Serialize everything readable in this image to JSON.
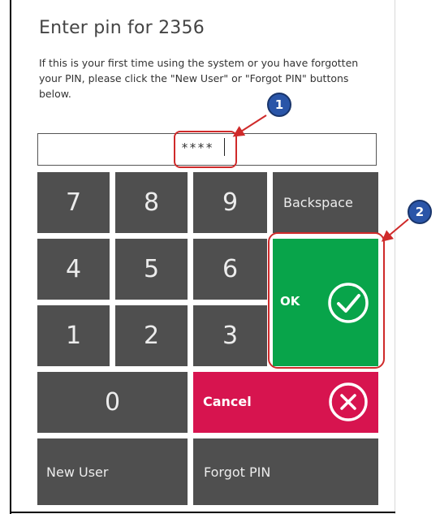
{
  "dialog": {
    "title": "Enter pin for 2356",
    "description": "If this is your first time using the system or you have forgotten your PIN, please click the \"New User\" or \"Forgot PIN\" buttons below."
  },
  "pin_input": {
    "value": "****"
  },
  "keypad": {
    "keys": [
      "7",
      "8",
      "9",
      "4",
      "5",
      "6",
      "1",
      "2",
      "3",
      "0"
    ],
    "backspace_label": "Backspace",
    "ok_label": "OK",
    "cancel_label": "Cancel",
    "new_user_label": "New User",
    "forgot_pin_label": "Forgot PIN"
  },
  "annotations": {
    "badge_1": "1",
    "badge_2": "2"
  },
  "colors": {
    "key": "#4f4f4f",
    "ok": "#08a44a",
    "cancel": "#d7144f",
    "highlight": "#cf2a2a",
    "badge": "#2a55a8"
  },
  "icons": {
    "ok": "check-circle-icon",
    "cancel": "x-circle-icon"
  }
}
